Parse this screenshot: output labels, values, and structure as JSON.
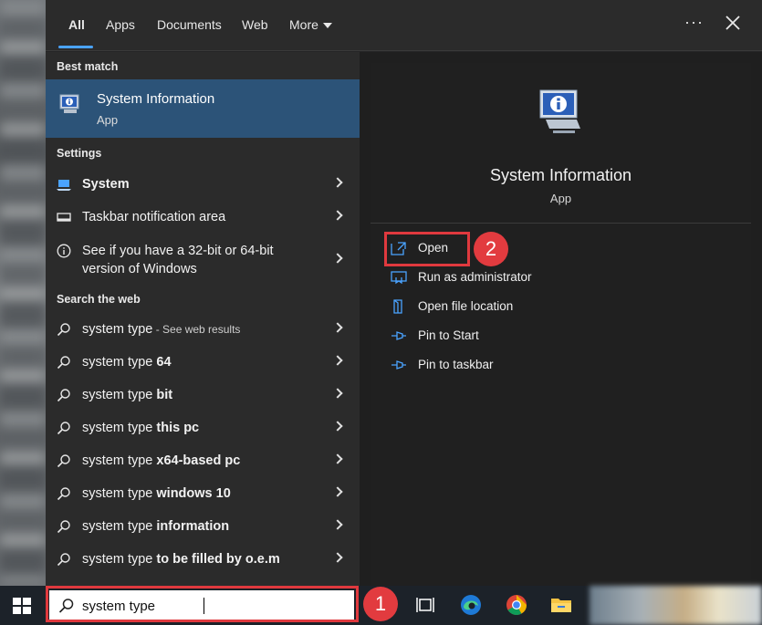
{
  "tabs": [
    {
      "label": "All",
      "active": true
    },
    {
      "label": "Apps"
    },
    {
      "label": "Documents"
    },
    {
      "label": "Web"
    },
    {
      "label": "More"
    }
  ],
  "header": {
    "more_options": "···"
  },
  "best_match": {
    "section": "Best match",
    "title": "System Information",
    "subtitle": "App",
    "icon": "system-information-icon"
  },
  "settings": {
    "section": "Settings",
    "items": [
      {
        "label": "System",
        "icon": "laptop-icon"
      },
      {
        "label": "Taskbar notification area",
        "icon": "taskbar-icon"
      },
      {
        "label": "See if you have a 32-bit or 64-bit version of Windows",
        "icon": "info-icon"
      }
    ]
  },
  "web": {
    "section": "Search the web",
    "items": [
      {
        "prefix": "system type",
        "bold": "",
        "hint": " - See web results"
      },
      {
        "prefix": "system type ",
        "bold": "64",
        "hint": ""
      },
      {
        "prefix": "system type ",
        "bold": "bit",
        "hint": ""
      },
      {
        "prefix": "system type ",
        "bold": "this pc",
        "hint": ""
      },
      {
        "prefix": "system type ",
        "bold": "x64-based pc",
        "hint": ""
      },
      {
        "prefix": "system type ",
        "bold": "windows 10",
        "hint": ""
      },
      {
        "prefix": "system type ",
        "bold": "information",
        "hint": ""
      },
      {
        "prefix": "system type ",
        "bold": "to be filled by o.e.m",
        "hint": ""
      }
    ]
  },
  "preview": {
    "title": "System Information",
    "subtitle": "App",
    "actions": [
      {
        "label": "Open",
        "icon": "open-icon"
      },
      {
        "label": "Run as administrator",
        "icon": "shield-icon"
      },
      {
        "label": "Open file location",
        "icon": "folder-location-icon"
      },
      {
        "label": "Pin to Start",
        "icon": "pin-icon"
      },
      {
        "label": "Pin to taskbar",
        "icon": "pin-icon"
      }
    ]
  },
  "annotations": {
    "step1": "1",
    "step2": "2",
    "color": "#e0393e"
  },
  "taskbar": {
    "search_value": "system type",
    "icons": [
      "task-view-icon",
      "edge-icon",
      "chrome-icon",
      "file-explorer-icon"
    ]
  },
  "colors": {
    "accent": "#4aa3ff",
    "best_match_bg": "#2c5378",
    "panel_bg": "#2b2b2b"
  }
}
